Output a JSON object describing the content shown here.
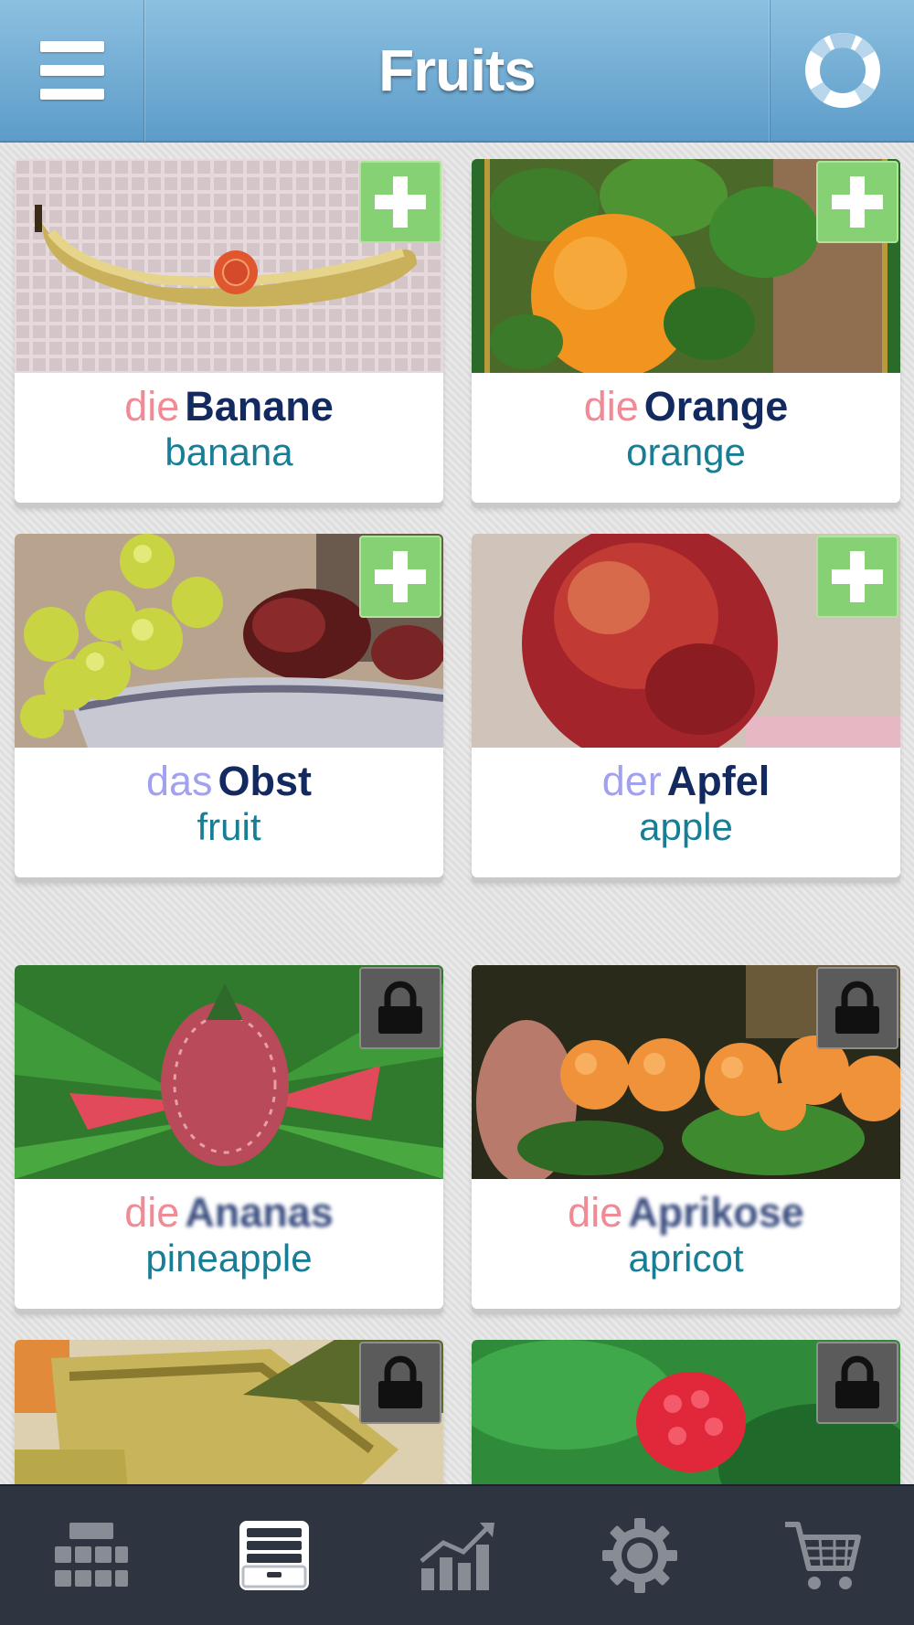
{
  "header": {
    "title": "Fruits",
    "menu_icon": "hamburger-menu-icon",
    "help_icon": "lifebuoy-help-icon"
  },
  "colors": {
    "header_top": "#8cc0e0",
    "header_bottom": "#5d9cc9",
    "article_die": "#f08a94",
    "article_das_der": "#a1a1f0",
    "noun": "#132a61",
    "translation": "#177e96",
    "add_badge": "#86d173",
    "lock_badge": "#5b5b5b",
    "tabbar": "#2e3440"
  },
  "cards": [
    {
      "article": "die",
      "noun": "Banane",
      "translation": "banana",
      "status": "add",
      "image": "banana-photo"
    },
    {
      "article": "die",
      "noun": "Orange",
      "translation": "orange",
      "status": "add",
      "image": "orange-photo"
    },
    {
      "article": "das",
      "noun": "Obst",
      "translation": "fruit",
      "status": "add",
      "image": "fruit-bowl-photo"
    },
    {
      "article": "der",
      "noun": "Apfel",
      "translation": "apple",
      "status": "add",
      "image": "apple-photo"
    },
    {
      "article": "die",
      "noun": "Ananas",
      "translation": "pineapple",
      "status": "locked",
      "image": "pineapple-photo"
    },
    {
      "article": "die",
      "noun": "Aprikose",
      "translation": "apricot",
      "status": "locked",
      "image": "apricot-photo"
    },
    {
      "article": "",
      "noun": "",
      "translation": "",
      "status": "locked",
      "image": "avocado-photo"
    },
    {
      "article": "",
      "noun": "",
      "translation": "",
      "status": "locked",
      "image": "raspberry-photo"
    }
  ],
  "tabbar": {
    "tabs": [
      {
        "icon": "grid-icon",
        "selected": false
      },
      {
        "icon": "card-box-icon",
        "selected": true
      },
      {
        "icon": "stats-chart-icon",
        "selected": false
      },
      {
        "icon": "gear-icon",
        "selected": false
      },
      {
        "icon": "shopping-cart-icon",
        "selected": false
      }
    ]
  }
}
